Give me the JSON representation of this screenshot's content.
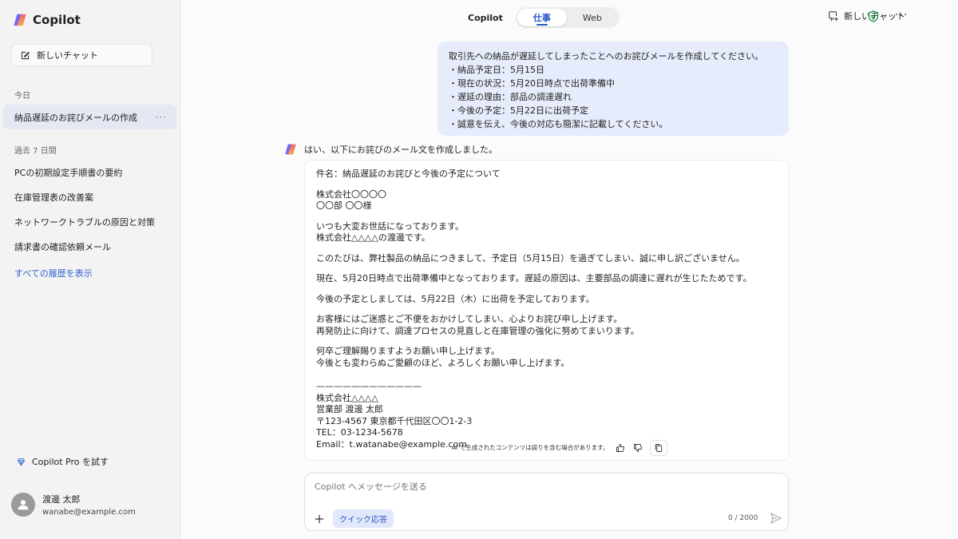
{
  "sidebar": {
    "brand": "Copilot",
    "new_chat": "新しいチャット",
    "today_label": "今日",
    "today_items": [
      {
        "label": "納品遅延のお詫びメールの作成",
        "more": "···"
      }
    ],
    "past_label": "過去 7 日間",
    "past_items": [
      {
        "label": "PCの初期設定手順書の要約"
      },
      {
        "label": "在庫管理表の改善案"
      },
      {
        "label": "ネットワークトラブルの原因と対策"
      },
      {
        "label": "請求書の確認依頼メール"
      }
    ],
    "show_all": "すべての履歴を表示",
    "pro": "Copilot Pro を試す",
    "user": {
      "name": "渡邊 太郎",
      "email": "wanabe@example.com"
    }
  },
  "topbar": {
    "title": "Copilot",
    "tabs": [
      {
        "label": "仕事",
        "active": true
      },
      {
        "label": "Web",
        "active": false
      }
    ],
    "new_chat": "新しいチャット",
    "more": "···"
  },
  "prompt": {
    "lines": [
      "取引先への納品が遅延してしまったことへのお詫びメールを作成してください。",
      "・納品予定日：5月15日",
      "・現在の状況：5月20日時点で出荷準備中",
      "・遅延の理由：部品の調達遅れ",
      "・今後の予定：5月22日に出荷予定",
      "・誠意を伝え、今後の対応も簡潔に記載してください。"
    ]
  },
  "reply": {
    "intro": "はい、以下にお詫びのメール文を作成しました。",
    "paragraphs": [
      [
        "件名：納品遅延のお詫びと今後の予定について"
      ],
      [
        "株式会社〇〇〇〇",
        "〇〇部 〇〇様"
      ],
      [
        "いつも大変お世話になっております。",
        "株式会社△△△△の渡邊です。"
      ],
      [
        "このたびは、弊社製品の納品につきまして、予定日（5月15日）を過ぎてしまい、誠に申し訳ございません。"
      ],
      [
        "現在、5月20日時点で出荷準備中となっております。遅延の原因は、主要部品の調達に遅れが生じたためです。"
      ],
      [
        "今後の予定としましては、5月22日（木）に出荷を予定しております。"
      ],
      [
        "お客様にはご迷惑とご不便をおかけしてしまい、心よりお詫び申し上げます。",
        "再発防止に向けて、調達プロセスの見直しと在庫管理の強化に努めてまいります。"
      ],
      [
        "何卒ご理解賜りますようお願い申し上げます。",
        "今後とも変わらぬご愛顧のほど、よろしくお願い申し上げます。"
      ],
      [
        "",
        "————————————",
        "株式会社△△△△",
        "営業部 渡邊 太郎",
        "〒123-4567 東京都千代田区〇〇1-2-3",
        "TEL：03-1234-5678",
        "Email：t.watanabe@example.com"
      ]
    ],
    "disclaimer": "AI で生成されたコンテンツは誤りを含む場合があります。"
  },
  "composer": {
    "placeholder": "Copilot へメッセージを送る",
    "quick_reply": "クイック応答",
    "counter": "0 / 2000"
  },
  "colors": {
    "accent": "#2457c5",
    "prompt_bg": "#e6ecfb",
    "active_item_bg": "#e4e8f3",
    "shield": "#1e9e4a"
  },
  "icons": [
    "copilot-logo-icon",
    "edit-icon",
    "gem-icon",
    "user-icon",
    "new-chat-icon",
    "shield-icon",
    "thumbs-up-icon",
    "thumbs-down-icon",
    "copy-icon",
    "plus-icon",
    "send-icon"
  ]
}
